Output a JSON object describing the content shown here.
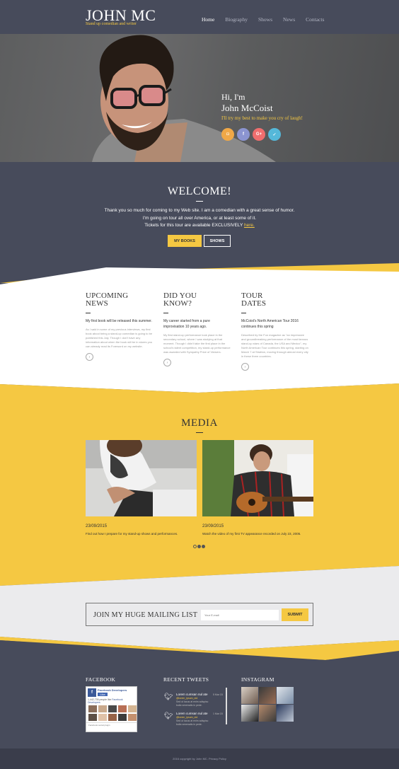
{
  "header": {
    "logo": "JOHN MC",
    "subtitle": "Stand up comedian and writer",
    "nav": [
      "Home",
      "Biography",
      "Shows",
      "News",
      "Contacts"
    ]
  },
  "hero": {
    "greeting": "Hi, I'm",
    "name": "John McCoist",
    "tagline": "I'll try my best to make you cry of laugh!",
    "socials": [
      {
        "icon": "instagram-icon",
        "glyph": "◘",
        "color": "#f0a847"
      },
      {
        "icon": "facebook-icon",
        "glyph": "f",
        "color": "#8b94d0"
      },
      {
        "icon": "google-plus-icon",
        "glyph": "G+",
        "color": "#ef6e6e"
      },
      {
        "icon": "twitter-icon",
        "glyph": "✓",
        "color": "#55b8d9"
      }
    ]
  },
  "welcome": {
    "title": "WELCOME!",
    "line1": "Thank you so much for coming to my Web site. I am a comedian with a great sense of humor.",
    "line2": "I'm going on tour all over America, or at least some of it.",
    "line3": "Tickets for this tour are available EXCLUSIVELY",
    "link": "here.",
    "btn_books": "MY BOOKS",
    "btn_shows": "SHOWS"
  },
  "columns": [
    {
      "title1": "UPCOMING",
      "title2": "NEWS",
      "lead": "My first book will be released this summer.",
      "body": "As I said in some of my previous interviews, my first book about being a stand-up comedian is going to be published this July. Though I don't have any information about when the book will be in stores you can already read its Foreword on my website."
    },
    {
      "title1": "DID YOU",
      "title2": "KNOW?",
      "lead": "My career started from a pure improvisation 10 years ago.",
      "body": "My first stand-up performance took place in the secondary school, where I was studying at that moment. Though I didn't take the first place in the school's talent competition, my stand-up performance was awarded with Sympathy Prize of Viewers."
    },
    {
      "title1": "TOUR",
      "title2": "DATES",
      "lead": "McCoist's North American Tour 2016 continues this spring",
      "body": "Described by the Fun magazine as \"an impressive and groundbreaking performance of the most famous stand-up stars of Canada, the USA and Mexico\", my North American Tour continues this spring, starting on March 7 at Stratton, moving through almost every city in these three countries."
    }
  ],
  "media": {
    "title": "MEDIA",
    "items": [
      {
        "date": "23/09/2015",
        "caption": "Find out how I prepare for my stand-up shows and performances."
      },
      {
        "date": "23/09/2015",
        "caption": "Watch the video of my first TV appearance recorded on July 23, 2005."
      }
    ]
  },
  "mailing": {
    "title": "JOIN MY HUGE MAILING LIST",
    "placeholder": "Your E-mail",
    "submit": "SUBMIT"
  },
  "footer": {
    "facebook": {
      "title": "FACEBOOK",
      "page_name": "Facebook Developers",
      "like": "Like",
      "likes_text": "1,442,735 people like",
      "likes_link": "Facebook Developers",
      "plugin": "Facebook social plugin"
    },
    "tweets": {
      "title": "RECENT TWEETS",
      "items": [
        {
          "text": "Lorem cumsan nul ate",
          "handle": "@lorem_ipsum_dol",
          "body": "Sed ut lacus at enim adispisc bulla venenatis in pede.",
          "date": "5 Mar 15"
        },
        {
          "text": "Lorem cumsan nul ate",
          "handle": "@lorem_ipsum_dol",
          "body": "Sed ut lacus at enim adispisc bulla venenatis in pede.",
          "date": "1 Mar 15"
        }
      ]
    },
    "instagram": {
      "title": "INSTAGRAM"
    },
    "copyright": "2016 copyright by John MC. Privacy Policy"
  },
  "colors": {
    "accent": "#f5c842",
    "dark": "#474b5b",
    "light": "#ebebed"
  }
}
